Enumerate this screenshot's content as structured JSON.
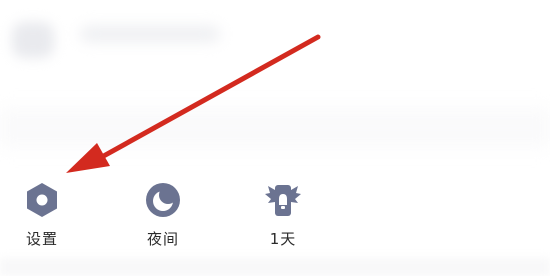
{
  "menu": {
    "items": [
      {
        "label": "设置",
        "icon": "gear-hexagon-icon"
      },
      {
        "label": "夜间",
        "icon": "moon-icon"
      },
      {
        "label": "1天",
        "icon": "angel-wings-icon"
      }
    ]
  },
  "colors": {
    "icon": "#6b7391",
    "arrow": "#d32a1f",
    "label": "#2b2b2b"
  }
}
